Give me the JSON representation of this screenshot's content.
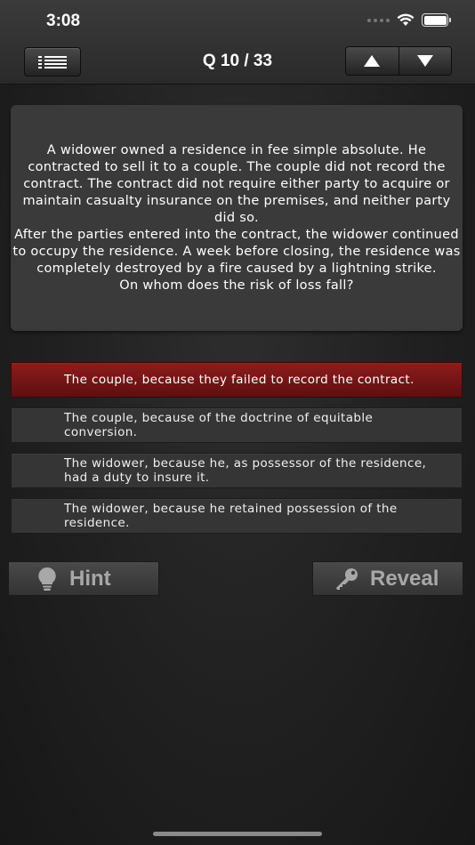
{
  "status_bar": {
    "time": "3:08"
  },
  "header": {
    "question_counter": "Q 10 / 33"
  },
  "icons": {
    "menu": "list-icon",
    "prev": "arrow-up-icon",
    "next": "arrow-down-icon",
    "hint": "lightbulb-icon",
    "reveal": "key-icon"
  },
  "question": {
    "text": "A widower owned a residence in fee simple absolute. He contracted to sell it to a couple. The couple did not record the contract. The contract did not require either party to acquire or maintain casualty insurance on the premises, and neither party did so.\nAfter the parties entered into the contract, the widower continued to occupy the residence. A week before closing, the residence was completely destroyed by a fire caused by a lightning strike.\nOn whom does the risk of loss fall?"
  },
  "answers": [
    {
      "text": "The couple, because they failed to record the contract.",
      "selected": true
    },
    {
      "text": "The couple, because of the doctrine of equitable conversion.",
      "selected": false
    },
    {
      "text": "The widower, because he, as possessor of the residence, had a duty to insure it.",
      "selected": false
    },
    {
      "text": "The widower, because he retained possession of the residence.",
      "selected": false
    }
  ],
  "actions": {
    "hint_label": "Hint",
    "reveal_label": "Reveal"
  },
  "colors": {
    "selected_answer": "#8e1c1c",
    "background": "#202020",
    "card": "#3a3a3a"
  }
}
